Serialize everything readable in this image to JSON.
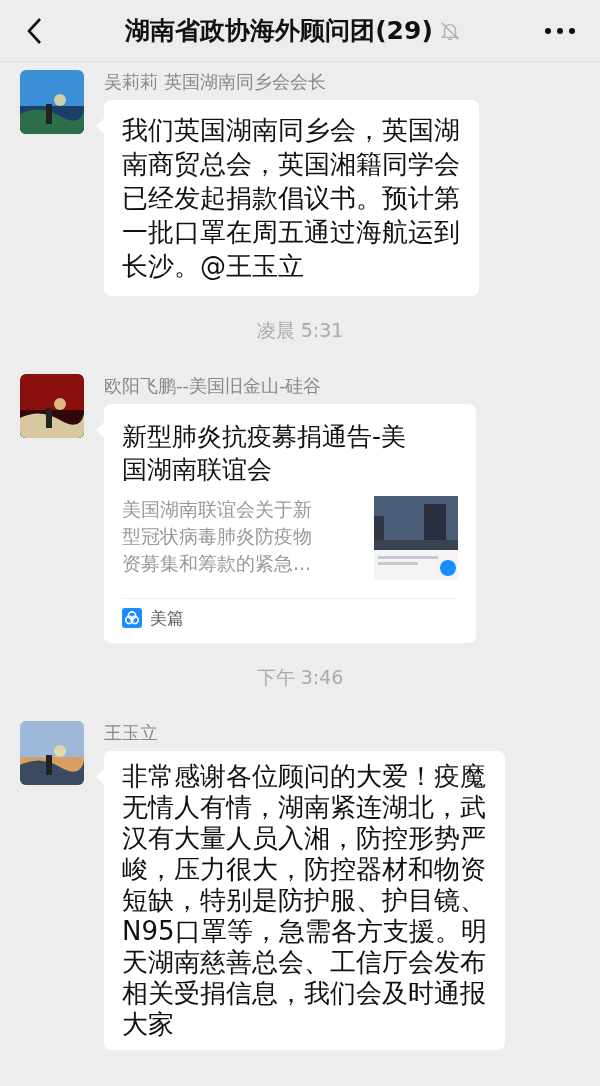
{
  "header": {
    "title": "湖南省政协海外顾问团(29)",
    "muted": true
  },
  "messages": [
    {
      "kind": "text",
      "sender": "吴莉莉 英国湖南同乡会会长",
      "text": "我们英国湖南同乡会，英国湖南商贸总会，英国湘籍同学会已经发起捐款倡议书。预计第一批口罩在周五通过海航运到长沙。@王玉立"
    },
    {
      "kind": "time",
      "text": "凌晨 5:31"
    },
    {
      "kind": "link",
      "sender": "欧阳飞鹏--美国旧金山-硅谷",
      "title": "新型肺炎抗疫募捐通告-美国湖南联谊会",
      "description": "美国湖南联谊会关于新型冠状病毒肺炎防疫物资募集和筹款的紧急...",
      "source": "美篇"
    },
    {
      "kind": "time",
      "text": "下午 3:46"
    },
    {
      "kind": "text",
      "sender": "王玉立",
      "text": "非常感谢各位顾问的大爱！疫魔无情人有情，湖南紧连湖北，武汉有大量人员入湘，防控形势严峻，压力很大，防控器材和物资短缺，特别是防护服、护目镜、N95口罩等，急需各方支援。明天湖南慈善总会、工信厅会发布相关受捐信息，我们会及时通报大家"
    }
  ]
}
